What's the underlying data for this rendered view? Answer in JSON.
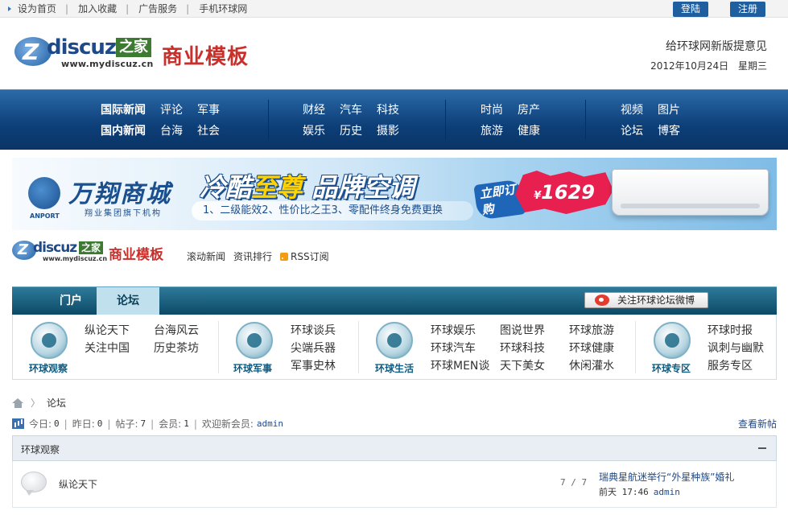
{
  "topbar": {
    "links": [
      "设为首页",
      "加入收藏",
      "广告服务",
      "手机环球网"
    ],
    "login": "登陆",
    "register": "注册"
  },
  "header": {
    "logo_text": "discuz",
    "logo_badge": "之家",
    "logo_title": "商业模板",
    "logo_url": "www.mydiscuz.cn",
    "feedback": "给环球网新版提意见",
    "date": "2012年10月24日 星期三"
  },
  "mainnav": {
    "groups": [
      {
        "row1": [
          "国际新闻",
          "评论",
          "军事"
        ],
        "row2": [
          "国内新闻",
          "台海",
          "社会"
        ]
      },
      {
        "row1": [
          "财经",
          "汽车",
          "科技"
        ],
        "row2": [
          "娱乐",
          "历史",
          "摄影"
        ]
      },
      {
        "row1": [
          "时尚",
          "房产"
        ],
        "row2": [
          "旅游",
          "健康"
        ]
      },
      {
        "row1": [
          "视频",
          "图片"
        ],
        "row2": [
          "论坛",
          "博客"
        ]
      }
    ]
  },
  "banner": {
    "brand": "万翔商城",
    "brand_sub_en": "ANPORT",
    "brand_sub_cn": "翔业集团旗下机构",
    "slogan_a": "冷酷",
    "slogan_b": "至尊",
    "slogan_c": " 品牌空调",
    "features": "1、二级能效2、性价比之王3、零配件终身免费更换",
    "buy": "立即订购",
    "price_symbol": "¥",
    "price": "1629"
  },
  "sublogo": {
    "links": [
      "滚动新闻",
      "资讯排行",
      "RSS订阅"
    ]
  },
  "tabs": {
    "items": [
      "门户",
      "论坛"
    ],
    "weibo": "关注环球论坛微博"
  },
  "categories": [
    {
      "name": "环球观察",
      "links": [
        "纵论天下",
        "台海风云",
        "关注中国",
        "历史茶坊"
      ]
    },
    {
      "name": "环球军事",
      "links": [
        "环球谈兵",
        "尖端兵器",
        "军事史林"
      ]
    },
    {
      "name": "环球生活",
      "links": [
        "环球娱乐",
        "图说世界",
        "环球旅游",
        "环球汽车",
        "环球科技",
        "环球健康",
        "环球MEN谈",
        "天下美女",
        "休闲灌水"
      ]
    },
    {
      "name": "环球专区",
      "links": [
        "环球时报",
        "讽刺与幽默",
        "服务专区"
      ]
    }
  ],
  "breadcrumb": {
    "current": "论坛"
  },
  "stats": {
    "today_label": "今日:",
    "today": "0",
    "yesterday_label": "昨日:",
    "yesterday": "0",
    "posts_label": "帖子:",
    "posts": "7",
    "members_label": "会员:",
    "members": "1",
    "welcome_label": "欢迎新会员:",
    "newest": "admin",
    "new_posts": "查看新帖"
  },
  "forum": {
    "category": "环球观察",
    "rows": [
      {
        "name": "纵论天下",
        "counts": "7 / 7",
        "last_title": "瑞典星航迷举行“外星种族”婚礼",
        "last_time": "前天 17:46",
        "last_author": "admin"
      }
    ]
  }
}
